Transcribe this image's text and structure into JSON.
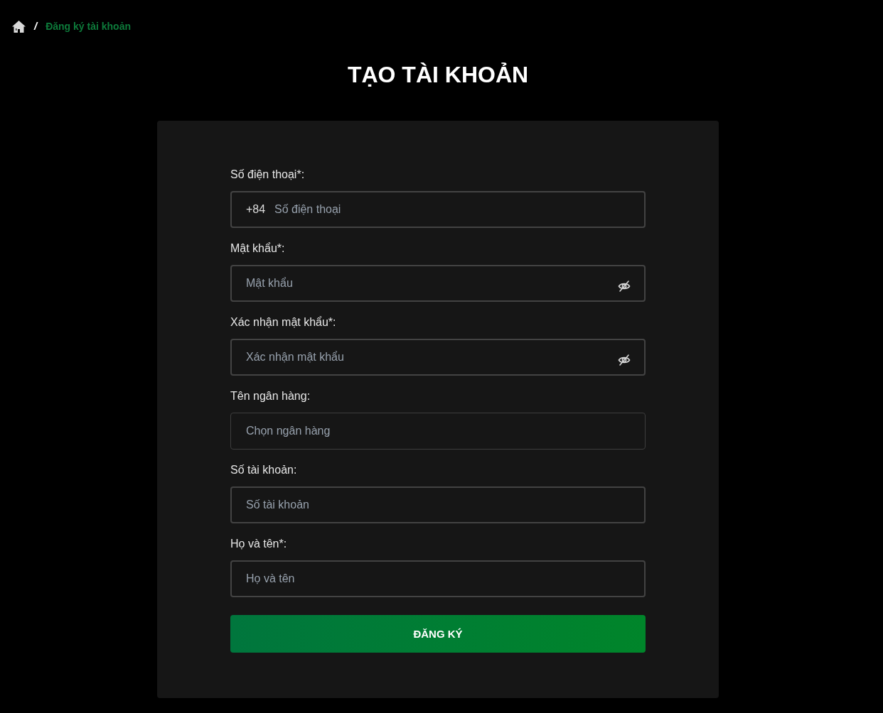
{
  "breadcrumb": {
    "separator": "/",
    "current": "Đăng ký tài khoản"
  },
  "title": "TẠO TÀI KHOẢN",
  "form": {
    "fields": [
      {
        "kind": "phone",
        "label": "Số điện thoại*:",
        "prefix": "+84",
        "placeholder": "Số điện thoại"
      },
      {
        "kind": "password",
        "label": "Mật khẩu*:",
        "placeholder": "Mật khẩu",
        "revealed": false
      },
      {
        "kind": "password",
        "label": "Xác nhận mật khẩu*:",
        "placeholder": "Xác nhận mật khẩu",
        "revealed": false
      },
      {
        "kind": "select",
        "label": "Tên ngân hàng:",
        "placeholder": "Chọn ngân hàng"
      },
      {
        "kind": "text",
        "label": "Số tài khoản:",
        "placeholder": "Số tài khoản"
      },
      {
        "kind": "text",
        "label": "Họ và tên*:",
        "placeholder": "Họ và tên"
      }
    ],
    "submit": "ĐĂNG KÝ"
  }
}
